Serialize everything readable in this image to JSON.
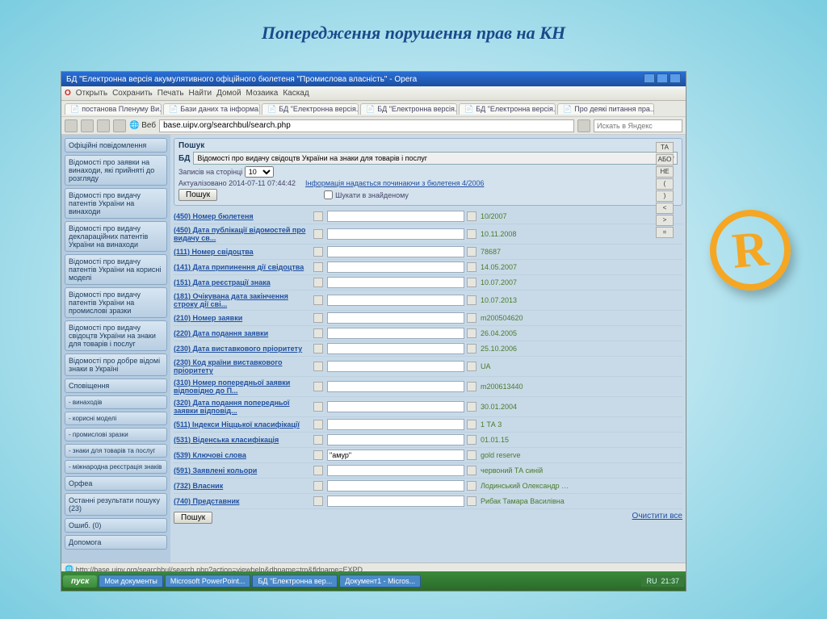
{
  "slide_title": "Попередження порушення прав на КН",
  "window_title": "БД \"Електронна версія акумулятивного офіційного бюлетеня \"Промислова власність\" - Opera",
  "menubar": [
    "Открыть",
    "Сохранить",
    "Печать",
    "Найти",
    "Домой",
    "Мозаика",
    "Каскад"
  ],
  "tabs": [
    "постанова Пленуму Ви...",
    "Бази даних та інформа...",
    "БД \"Електронна версія...",
    "БД \"Електронна версія...",
    "БД \"Електронна версія...",
    "Про деякі питання пра..."
  ],
  "url": "base.uipv.org/searchbul/search.php",
  "searchbox_placeholder": "Искать в Яндекс",
  "sidebar": [
    "Офіційні повідомлення",
    "Відомості про заявки на винаходи, які прийняті до розгляду",
    "Відомості про видачу патентів України на винаходи",
    "Відомості про видачу деклараційних патентів України на винаходи",
    "Відомості про видачу патентів України на корисні моделі",
    "Відомості про видачу патентів України на промислові зразки",
    "Відомості про видачу свідоцтв України на знаки для товарів і послуг",
    "Відомості про добре відомі знаки в Україні",
    "Сповіщення",
    "Орфеа",
    "Останні результати пошуку (23)",
    "Ошиб. (0)",
    "Допомога"
  ],
  "sidebar_sub": [
    "- винаходів",
    "- корисні моделі",
    "- промислові зразки",
    "- знаки для товарів та послуг",
    "- міжнародна реєстрація знаків"
  ],
  "panel_title": "Пошук",
  "db_label": "БД",
  "db_value": "Відомості про видачу свідоцтв України на знаки для товарів і послуг",
  "records_label": "Записів на сторінці",
  "records_value": "10",
  "updated": "Актуалізовано 2014-07-11 07:44:42",
  "info_link": "Інформація надається починаючи з бюлетеня 4/2006",
  "search_in_found": "Шукати в знайденому",
  "btn_search": "Пошук",
  "btn_clear": "Очистити все",
  "ops": [
    "ТА",
    "АБО",
    "НЕ",
    "(",
    ")",
    "<",
    ">",
    "="
  ],
  "fields": [
    {
      "label": "(450) Номер бюлетеня",
      "hint": "10/2007"
    },
    {
      "label": "(450) Дата публікації відомостей про видачу св...",
      "hint": "10.11.2008"
    },
    {
      "label": "(111) Номер свідоцтва",
      "hint": "78687"
    },
    {
      "label": "(141) Дата припинення дії свідоцтва",
      "hint": "14.05.2007"
    },
    {
      "label": "(151) Дата реєстрації знака",
      "hint": "10.07.2007"
    },
    {
      "label": "(181) Очікувана дата закінчення строку дії сві...",
      "hint": "10.07.2013"
    },
    {
      "label": "(210) Номер заявки",
      "hint": "m200504620"
    },
    {
      "label": "(220) Дата подання заявки",
      "hint": "26.04.2005"
    },
    {
      "label": "(230) Дата виставкового пріоритету",
      "hint": "25.10.2006"
    },
    {
      "label": "(230) Код країни виставкового пріоритету",
      "hint": "UA"
    },
    {
      "label": "(310) Номер попередньої заявки відповідно до П...",
      "hint": "m200613440"
    },
    {
      "label": "(320) Дата подання попередньої заявки відповід...",
      "hint": "30.01.2004"
    },
    {
      "label": "(511) Індекси Ніццької класифікації",
      "hint": "1 ТА 3"
    },
    {
      "label": "(531) Віденська класифікація",
      "hint": "01.01.15"
    },
    {
      "label": "(539) Ключові слова",
      "hint": "gold reserve",
      "value": "\"амур\""
    },
    {
      "label": "(591) Заявлені кольори",
      "hint": "червоний ТА синій"
    },
    {
      "label": "(732) Власник",
      "hint": "Лодинський Олександр Олегович"
    },
    {
      "label": "(740) Представник",
      "hint": "Рибак Тамара Василівна"
    }
  ],
  "statusbar": "http://base.uipv.org/searchbul/search.php?action=viewhelp&dbname=tm&fldname=EXPD",
  "taskbar": {
    "start": "пуск",
    "items": [
      "Мои документы",
      "Microsoft PowerPoint...",
      "БД \"Електронна вер...",
      "Документ1 - Micros..."
    ],
    "lang": "RU",
    "time": "21:37"
  }
}
